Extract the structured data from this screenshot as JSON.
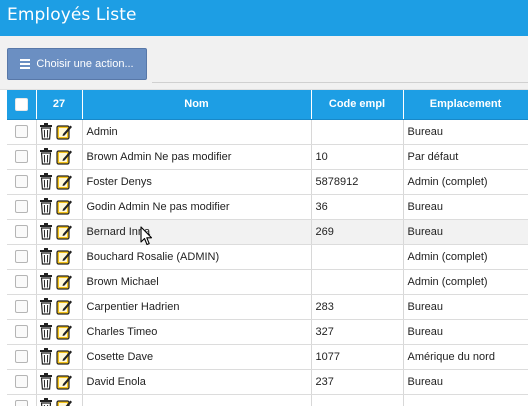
{
  "page": {
    "title": "Employés Liste"
  },
  "toolbar": {
    "action_label": "Choisir une action..."
  },
  "table": {
    "columns": [
      "",
      "27",
      "Nom",
      "Code empl",
      "Emplacement"
    ],
    "rows": [
      {
        "name": "Admin",
        "code": "",
        "location": "Bureau"
      },
      {
        "name": "Brown Admin Ne pas modifier",
        "code": "10",
        "location": "Par défaut"
      },
      {
        "name": "Foster Denys",
        "code": "5878912",
        "location": "Admin (complet)"
      },
      {
        "name": "Godin Admin Ne pas modifier",
        "code": "36",
        "location": "Bureau"
      },
      {
        "name": "Bernard Inna",
        "code": "269",
        "location": "Bureau"
      },
      {
        "name": "Bouchard Rosalie (ADMIN)",
        "code": "",
        "location": "Admin (complet)"
      },
      {
        "name": "Brown Michael",
        "code": "",
        "location": "Admin (complet)"
      },
      {
        "name": "Carpentier Hadrien",
        "code": "283",
        "location": "Bureau"
      },
      {
        "name": "Charles Timeo",
        "code": "327",
        "location": "Bureau"
      },
      {
        "name": "Cosette Dave",
        "code": "1077",
        "location": "Amérique du nord"
      },
      {
        "name": "David Enola",
        "code": "237",
        "location": "Bureau"
      },
      {
        "name": "",
        "code": "",
        "location": ""
      }
    ]
  },
  "colors": {
    "header": "#1d9ee4",
    "action_button": "#6b8fc2",
    "edit_icon": "#f4c21b"
  },
  "icons": {
    "row_delete": "trash-icon",
    "row_edit": "edit-icon",
    "cursor": "mouse-pointer-icon"
  }
}
